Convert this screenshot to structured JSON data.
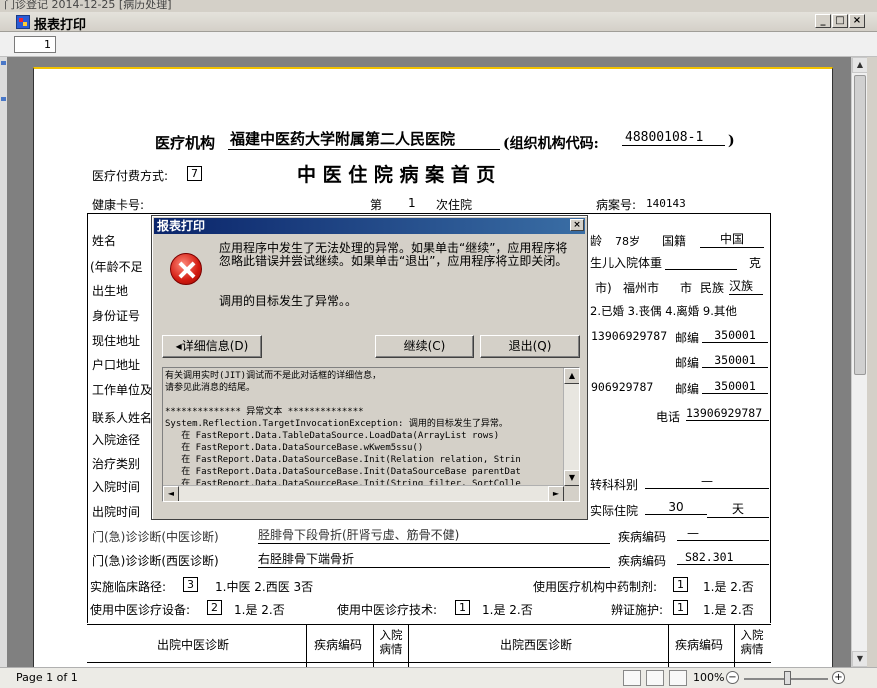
{
  "topstrip": {
    "text": "门诊登记   2014-12-25   [病历处理]"
  },
  "window": {
    "title": "报表打印",
    "min": "_",
    "max": "□",
    "close": "×"
  },
  "toolbar": {
    "page_input": "1"
  },
  "status": {
    "page_info": "Page 1 of 1",
    "zoom": "100%",
    "zoom_minus": "−",
    "zoom_plus": "+"
  },
  "paper": {
    "org_label": "医疗机构",
    "org_name": "福建中医药大学附属第二人民医院",
    "org_code_label": "(组织机构代码:",
    "org_code": "48800108-1",
    "org_code_close": ")",
    "pay_label": "医疗付费方式:",
    "pay_value": "7",
    "title": "中 医 住 院 病 案 首 页",
    "card_label": "健康卡号:",
    "visit_pre": "第",
    "visit_num": "1",
    "visit_post": "次住院",
    "record_label": "病案号:",
    "record_no": "140143",
    "name_label": "姓名",
    "age_tail": "龄",
    "age": "78岁",
    "nation_label": "国籍",
    "nation": "中国",
    "agenot_label": "(年龄不足",
    "baby_weight": "生儿入院体重",
    "weight_unit": "克",
    "birth_label": "出生地",
    "city_tail": "市)",
    "native_city": "福州市",
    "native_suffix": "市",
    "ethnic_label": "民族",
    "ethnic": "汉族",
    "id_label": "身份证号",
    "marriage": "2.已婚 3.丧偶 4.离婚 9.其他",
    "addr_label": "现住地址",
    "phone1": "13906929787",
    "zip_label": "邮编",
    "zip1": "350001",
    "hukou_label": "户口地址",
    "zip2": "350001",
    "work_label": "工作单位及",
    "phone2": "906929787",
    "zip3": "350001",
    "contact_label": "联系人姓名",
    "phone_label": "电话",
    "phone3": "13906929787",
    "admit_route": "入院途径",
    "treat_type": "治疗类别",
    "admit_time": "入院时间",
    "transfer_dept": "转科科别",
    "transfer_value": "—",
    "discharge_time": "出院时间",
    "actual_stay": "实际住院",
    "stay_days": "30",
    "day_unit": "天",
    "tcm_diag_label": "门(急)诊诊断(中医诊断)",
    "tcm_diag_value": "胫腓骨下段骨折(肝肾亏虚、筋骨不健)",
    "disease_code_label": "疾病编码",
    "tcm_code": "—",
    "wm_diag_label": "门(急)诊诊断(西医诊断)",
    "wm_diag_value": "右胫腓骨下端骨折",
    "wm_code": "S82.301",
    "path_label": "实施临床路径:",
    "path_value": "3",
    "path_opts": "1.中医     2.西医     3否",
    "drug_label": "使用医疗机构中药制剂:",
    "drug_value": "1",
    "drug_opts": "1.是    2.否",
    "equip_label": "使用中医诊疗设备:",
    "equip_value": "2",
    "equip_opts": "1.是    2.否",
    "tech_label": "使用中医诊疗技术:",
    "tech_value": "1",
    "tech_opts": "1.是    2.否",
    "syndrome_label": "辨证施护:",
    "syndrome_value": "1",
    "syndrome_opts": "1.是    2.否",
    "col_out_tcm": "出院中医诊断",
    "col_code": "疾病编码",
    "col_admit_state": "入院病情",
    "col_out_wm": "出院西医诊断",
    "col_code2": "疾病编码",
    "col_admit_state2": "入院病情"
  },
  "dialog": {
    "title": "报表打印",
    "close": "×",
    "message": "应用程序中发生了无法处理的异常。如果单击“继续”，应用程序将忽略此错误并尝试继续。如果单击“退出”，应用程序将立即关闭。",
    "message2": "调用的目标发生了异常。。",
    "details_btn": "◂详细信息(D)",
    "continue_btn": "继续(C)",
    "quit_btn": "退出(Q)",
    "detail_text": "有关调用实时(JIT)调试而不是此对话框的详细信息，\n请参见此消息的结尾。\n\n************** 异常文本 **************\nSystem.Reflection.TargetInvocationException: 调用的目标发生了异常。\n   在 FastReport.Data.TableDataSource.LoadData(ArrayList rows)\n   在 FastReport.Data.DataSourceBase.wKwem5ssu()\n   在 FastReport.Data.DataSourceBase.Init(Relation relation, Strin\n   在 FastReport.Data.DataSourceBase.Init(DataSourceBase parentDat\n   在 FastReport.Data.DataSourceBase.Init(String filter, SortColle\n   在 FastReport.Data.DataSourceBase.Init()",
    "scroll_up": "▲",
    "scroll_down": "▼",
    "scroll_left": "◄",
    "scroll_right": "►"
  }
}
